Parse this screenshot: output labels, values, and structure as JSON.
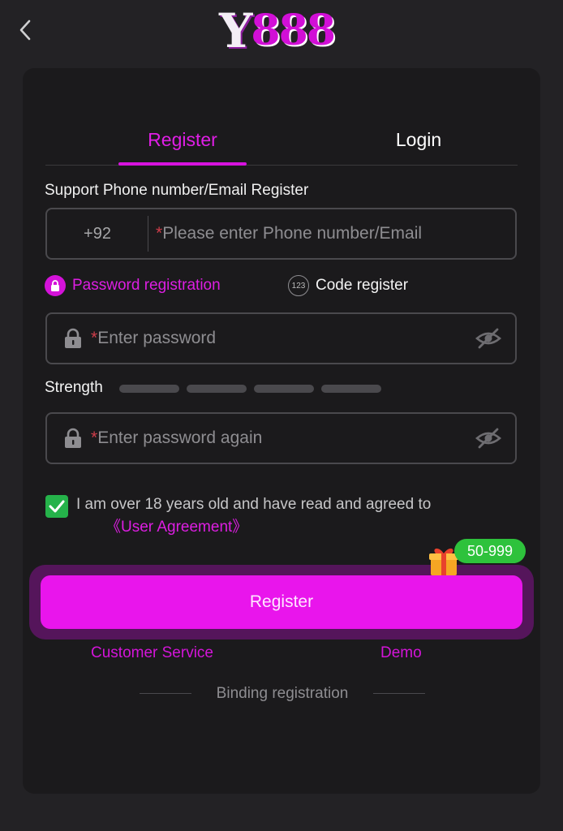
{
  "header": {
    "back_icon": "chevron-left-icon",
    "logo": {
      "prefix": "Y",
      "number": "888"
    }
  },
  "tabs": [
    {
      "label": "Register",
      "active": true
    },
    {
      "label": "Login",
      "active": false
    }
  ],
  "form": {
    "section_label": "Support Phone number/Email Register",
    "phone": {
      "country_code": "+92",
      "required_mark": "*",
      "placeholder": "Please enter Phone number/Email"
    },
    "modes": [
      {
        "label": "Password registration",
        "icon": "lock-icon",
        "active": true
      },
      {
        "label": "Code register",
        "icon": "code-123-icon",
        "icon_text": "123",
        "active": false
      }
    ],
    "password": {
      "required_mark": "*",
      "placeholder": "Enter password",
      "icon": "lock-icon",
      "toggle_icon": "eye-slash-icon"
    },
    "strength_label": "Strength",
    "password_confirm": {
      "required_mark": "*",
      "placeholder": "Enter password again",
      "icon": "lock-icon",
      "toggle_icon": "eye-slash-icon"
    },
    "agreement": {
      "checked": true,
      "text": "I am over 18 years old and have read and agreed to",
      "link": "《User Agreement》"
    },
    "register_button": "Register",
    "bonus_badge": "50-999",
    "customer_service": "Customer Service",
    "demo": "Demo",
    "binding_registration": "Binding registration"
  },
  "colors": {
    "accent": "#e915ec",
    "background": "#232225",
    "card": "#1b1a1c",
    "check": "#25b24a",
    "badge": "#2ec23c"
  }
}
